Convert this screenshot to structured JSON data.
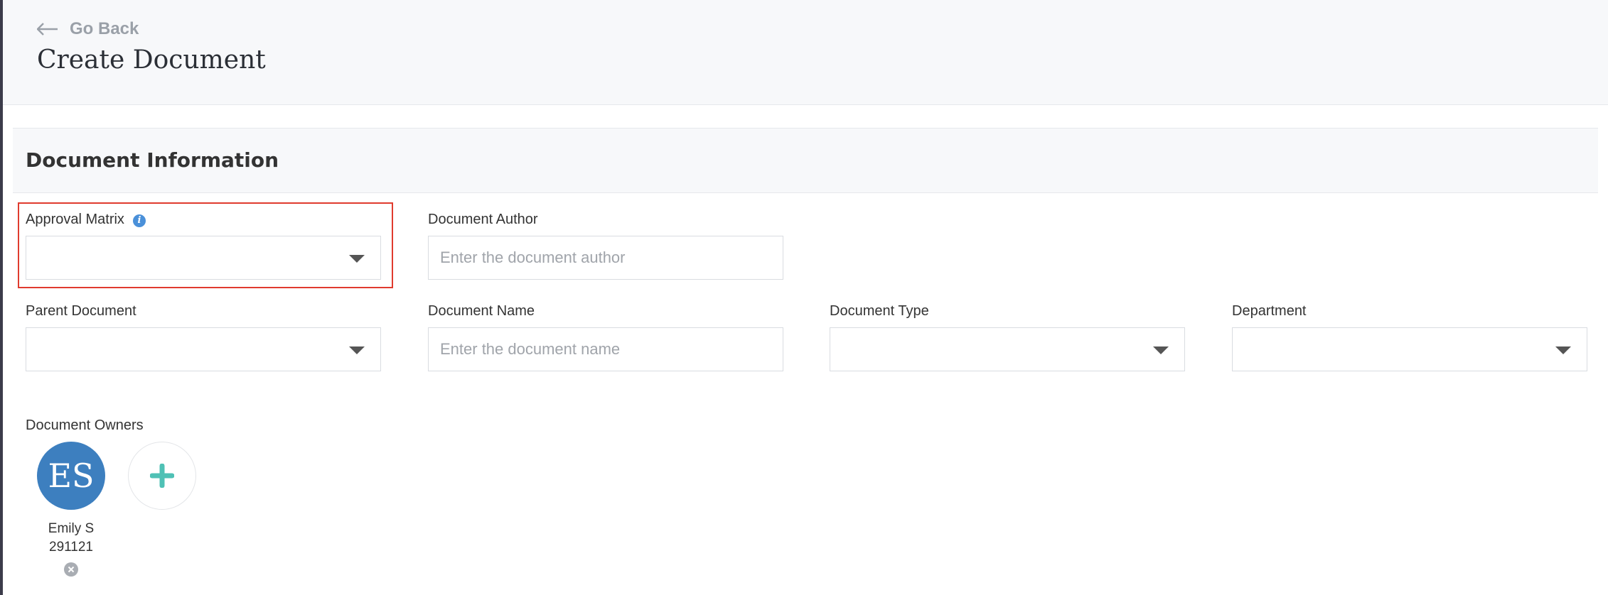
{
  "header": {
    "back_label": "Go Back",
    "title": "Create Document"
  },
  "section": {
    "title": "Document Information"
  },
  "fields": {
    "approval_matrix": {
      "label": "Approval Matrix",
      "value": ""
    },
    "document_author": {
      "label": "Document Author",
      "value": "",
      "placeholder": "Enter the document author"
    },
    "parent_document": {
      "label": "Parent Document",
      "value": ""
    },
    "document_name": {
      "label": "Document Name",
      "value": "",
      "placeholder": "Enter the document name"
    },
    "document_type": {
      "label": "Document Type",
      "value": ""
    },
    "department": {
      "label": "Department",
      "value": ""
    }
  },
  "owners": {
    "label": "Document Owners",
    "items": [
      {
        "initials": "ES",
        "name_line1": "Emily S",
        "name_line2": "291121"
      }
    ]
  },
  "colors": {
    "avatar": "#3d7fbf",
    "add_plus": "#4fc1b5",
    "highlight": "#e03b2e",
    "info_icon": "#4a90d9"
  },
  "icons": {
    "back": "arrow-left-icon",
    "info": "info-icon",
    "caret": "caret-down-icon",
    "remove": "close-circle-icon",
    "add": "plus-icon"
  }
}
